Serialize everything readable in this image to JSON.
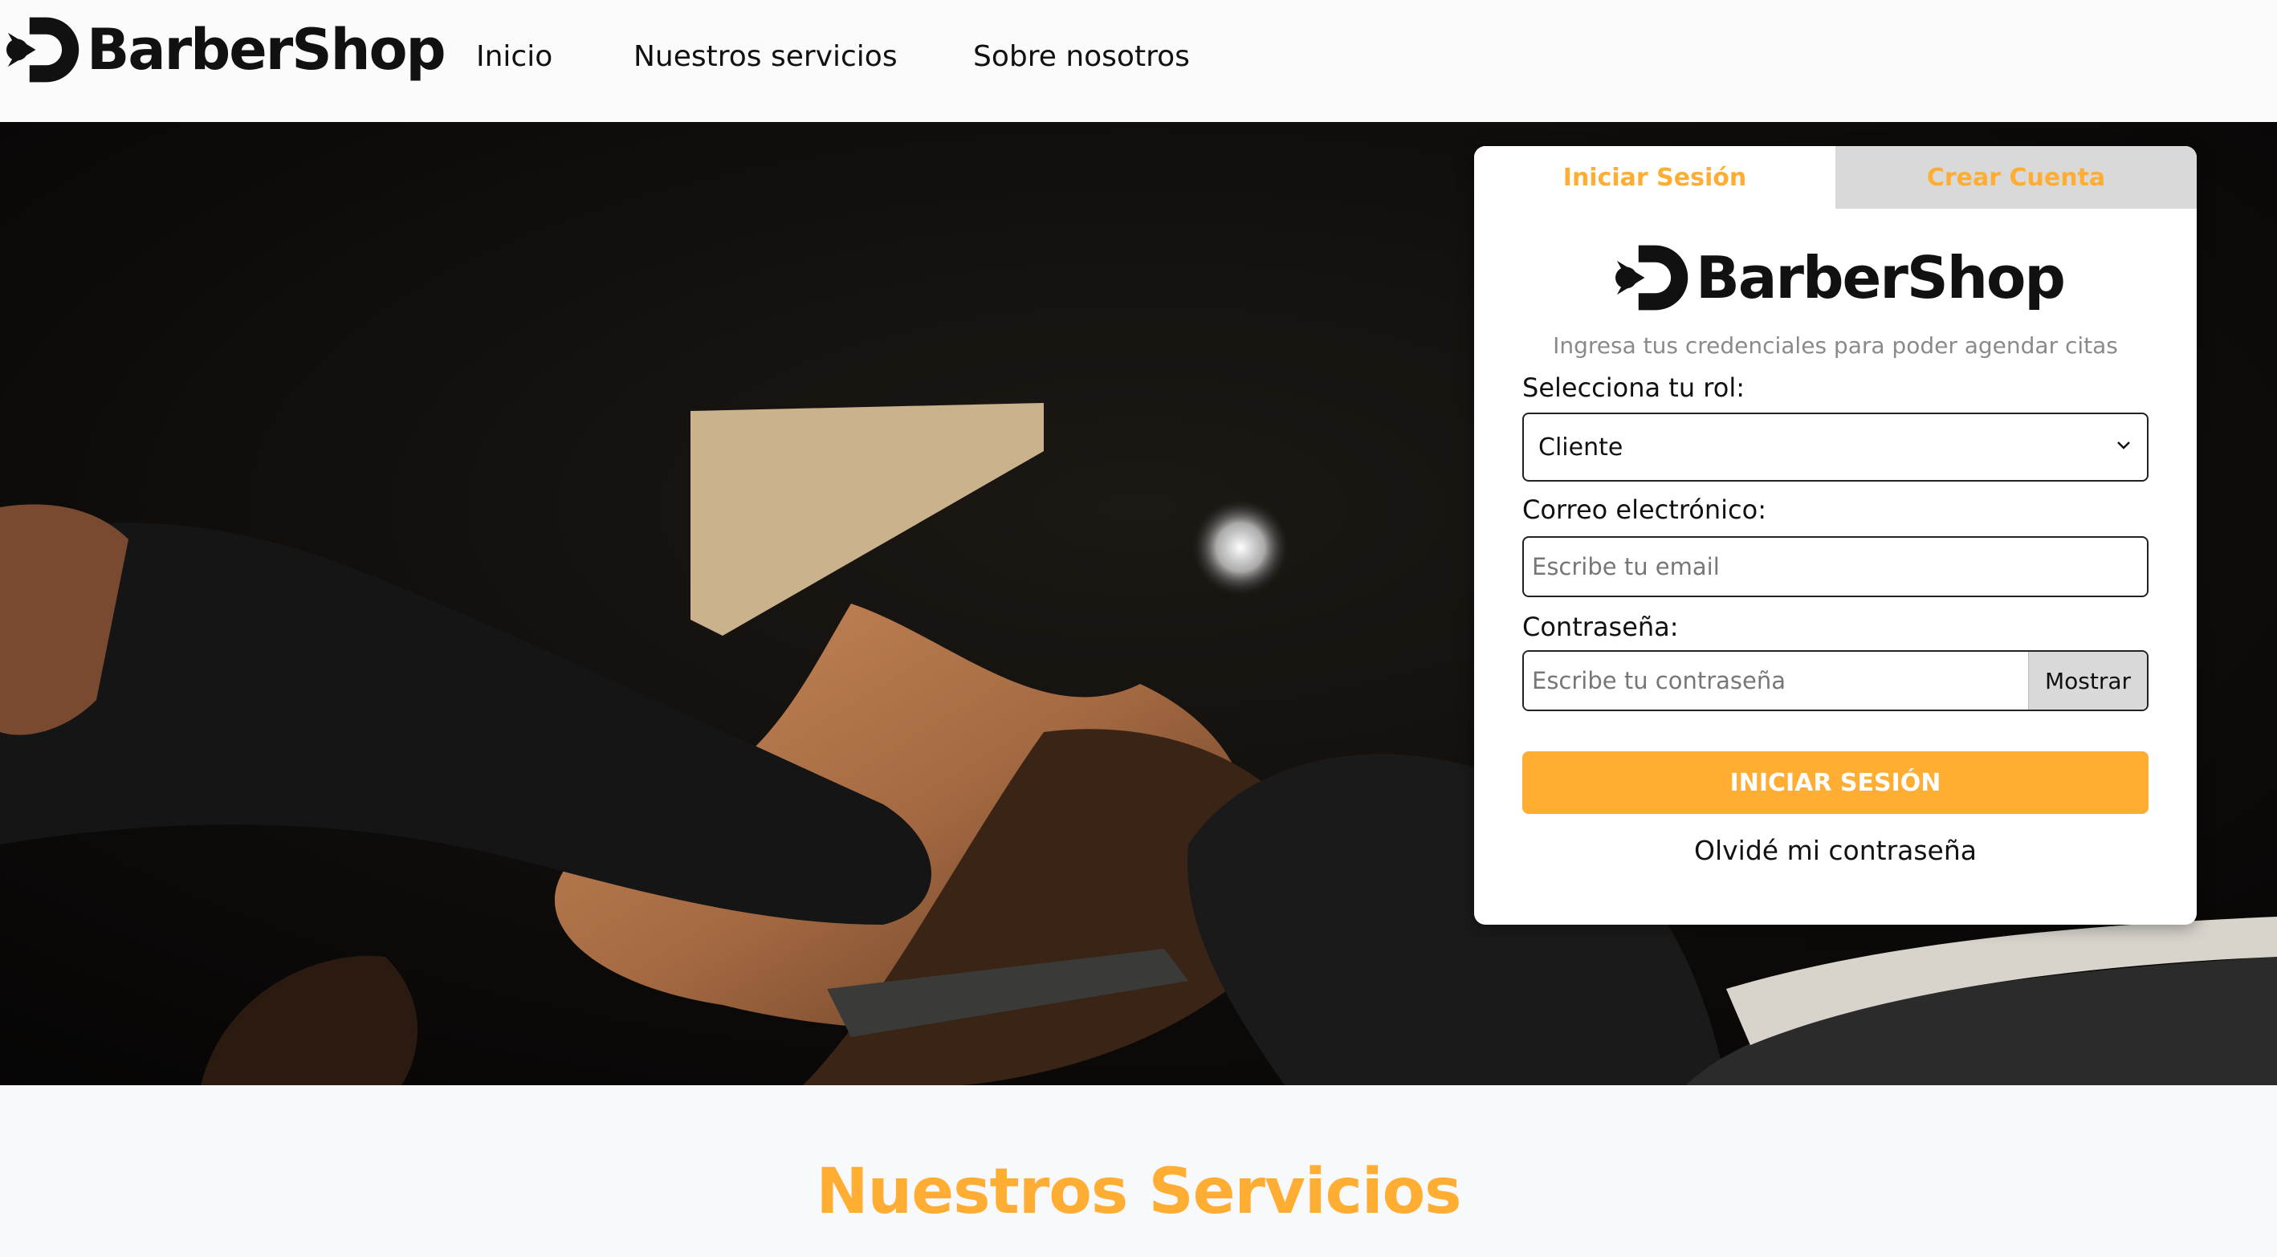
{
  "brand": {
    "name": "BarberShop",
    "logo_icon": "barbershop-logo-icon"
  },
  "nav": {
    "links": [
      {
        "label": "Inicio"
      },
      {
        "label": "Nuestros servicios"
      },
      {
        "label": "Sobre nosotros"
      }
    ]
  },
  "hero": {
    "image": "barber shaving client with straight razor"
  },
  "login_card": {
    "tabs": [
      {
        "label": "Iniciar Sesión",
        "active": true
      },
      {
        "label": "Crear Cuenta",
        "active": false
      }
    ],
    "logo_text": "BarberShop",
    "subtitle": "Ingresa tus credenciales para poder agendar citas",
    "role_label": "Selecciona tu rol:",
    "role_value": "Cliente",
    "email_label": "Correo electrónico:",
    "email_placeholder": "Escribe tu email",
    "password_label": "Contraseña:",
    "password_placeholder": "Escribe tu contraseña",
    "show_button": "Mostrar",
    "submit_label": "INICIAR SESIÓN",
    "forgot_label": "Olvidé mi contraseña"
  },
  "services": {
    "title": "Nuestros Servicios"
  },
  "colors": {
    "accent": "#ffad33",
    "tab_inactive": "#d9d9d9",
    "text": "#111111"
  }
}
